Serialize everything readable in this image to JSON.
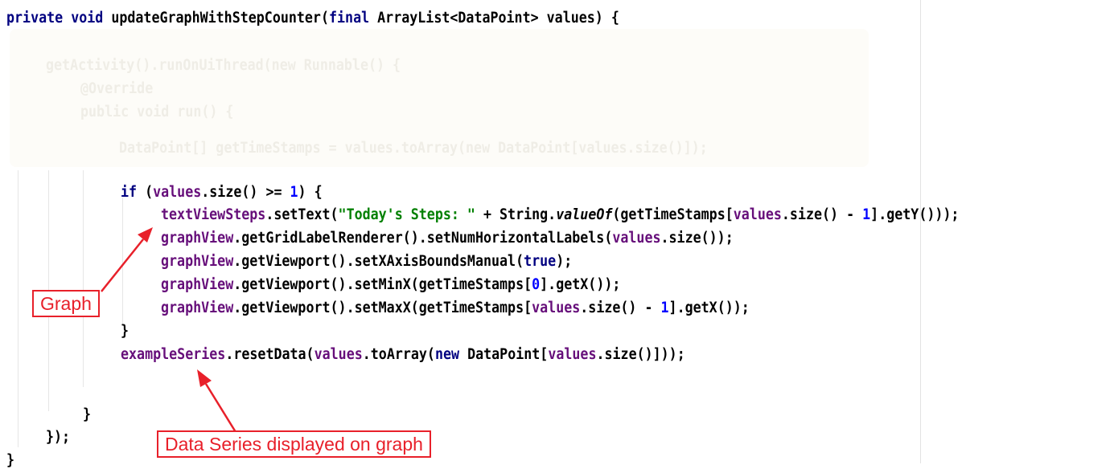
{
  "code": {
    "line1": {
      "kw1": "private",
      "kw2": "void",
      "name": "updateGraphWithStepCounter(",
      "kw3": "final",
      "rest": "ArrayList<DataPoint> values) {"
    },
    "faded": {
      "l2": "getActivity().runOnUiThread(new Runnable() {",
      "l3": "@Override",
      "l4": "public void run() {",
      "l5": "DataPoint[] getTimeStamps = values.toArray(new DataPoint[values.size()]);"
    },
    "if_line": {
      "kw": "if",
      "p1": " (",
      "fld": "values",
      "p2": ".size() >= ",
      "num": "1",
      "p3": ") {"
    },
    "settext_line": {
      "fld": "textViewSteps",
      "p1": ".setText(",
      "str": "\"Today's Steps: \"",
      "p2": " + String.",
      "it": "valueOf",
      "p3": "(getTimeStamps[",
      "fld2": "values",
      "p4": ".size() - ",
      "num": "1",
      "p5": "].getY()));"
    },
    "labels_line": {
      "fld": "graphView",
      "p1": ".getGridLabelRenderer().setNumHorizontalLabels(",
      "fld2": "values",
      "p2": ".size());"
    },
    "bounds_line": {
      "fld": "graphView",
      "p1": ".getViewport().setXAxisBoundsManual(",
      "kw": "true",
      "p2": ");"
    },
    "minx_line": {
      "fld": "graphView",
      "p1": ".getViewport().setMinX(getTimeStamps[",
      "num": "0",
      "p2": "].getX());"
    },
    "maxx_line": {
      "fld": "graphView",
      "p1": ".getViewport().setMaxX(getTimeStamps[",
      "fld2": "values",
      "p2": ".size() - ",
      "num": "1",
      "p3": "].getX());"
    },
    "close_if": "}",
    "reset_line": {
      "fld": "exampleSeries",
      "p1": ".resetData(",
      "fld2": "values",
      "p2": ".toArray(",
      "kw": "new",
      "p3": " DataPoint[",
      "fld3": "values",
      "p4": ".size()]));"
    },
    "close_run": "}",
    "close_runnable": "});",
    "close_method": "}"
  },
  "annotations": {
    "graph_label": "Graph",
    "series_label": "Data Series displayed on graph",
    "color": "#e8202a"
  }
}
